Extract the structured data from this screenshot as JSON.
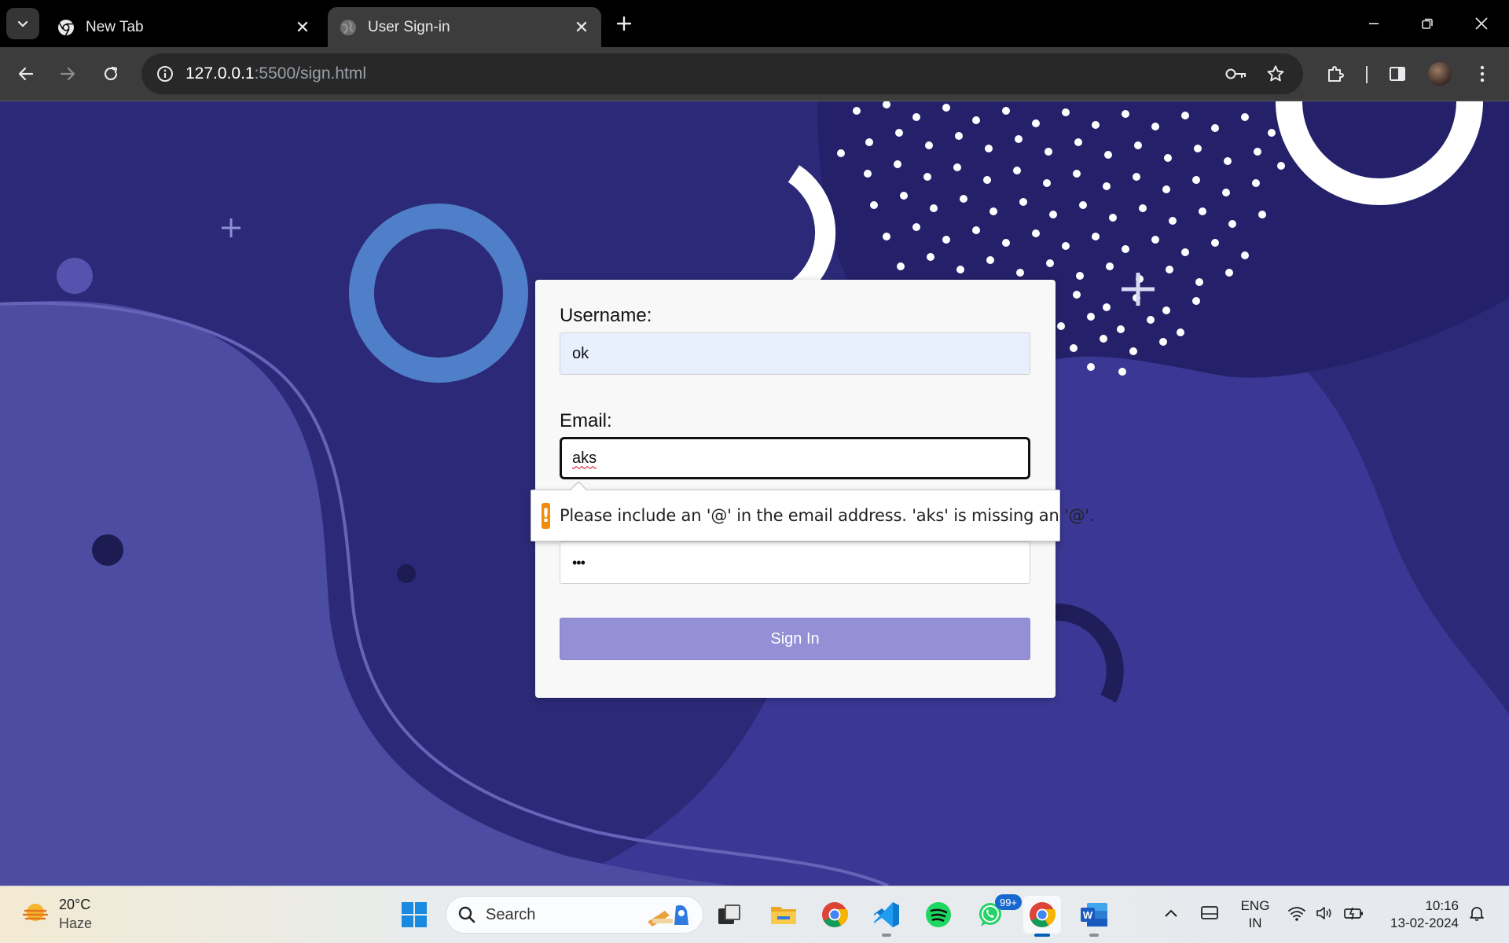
{
  "browser": {
    "tabs": [
      {
        "title": "New Tab",
        "active": false
      },
      {
        "title": "User Sign-in",
        "active": true
      }
    ],
    "url": {
      "host": "127.0.0.1",
      "path": ":5500/sign.html"
    }
  },
  "form": {
    "username_label": "Username:",
    "username_value": "ok",
    "email_label": "Email:",
    "email_value": "aks",
    "password_value": "•••",
    "submit_label": "Sign In"
  },
  "validation": {
    "message": "Please include an '@' in the email address. 'aks' is missing an '@'.",
    "icon": "!"
  },
  "taskbar": {
    "weather": {
      "temp": "20°C",
      "desc": "Haze"
    },
    "search_label": "Search",
    "whatsapp_badge": "99+",
    "lang_line1": "ENG",
    "lang_line2": "IN",
    "time": "10:16",
    "date": "13-02-2024"
  },
  "colors": {
    "page_bg": "#2c2a78",
    "button": "#9390d6",
    "warning": "#f28c0f",
    "autofill": "#e8f0fe"
  }
}
